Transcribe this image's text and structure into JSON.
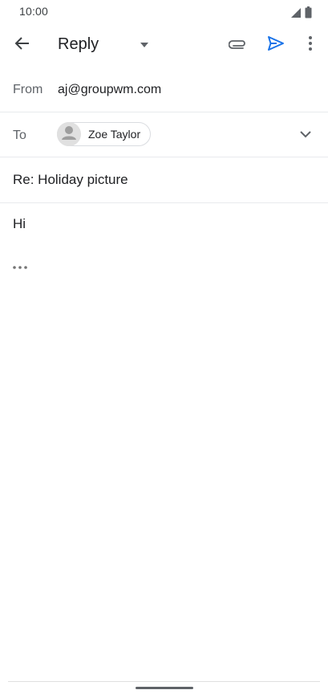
{
  "status_bar": {
    "time": "10:00",
    "icons": [
      "signal-icon",
      "battery-icon"
    ]
  },
  "toolbar": {
    "title": "Reply",
    "icons": [
      "back-arrow-icon",
      "dropdown-arrow-icon",
      "attach-icon",
      "send-icon",
      "more-vert-icon"
    ],
    "accent_color": "#1a73e8"
  },
  "compose": {
    "from_label": "From",
    "from_value": "aj@groupwm.com",
    "to_label": "To",
    "recipients": [
      {
        "name": "Zoe Taylor",
        "icon": "person-icon"
      }
    ],
    "subject": "Re: Holiday picture",
    "body": "Hi"
  }
}
